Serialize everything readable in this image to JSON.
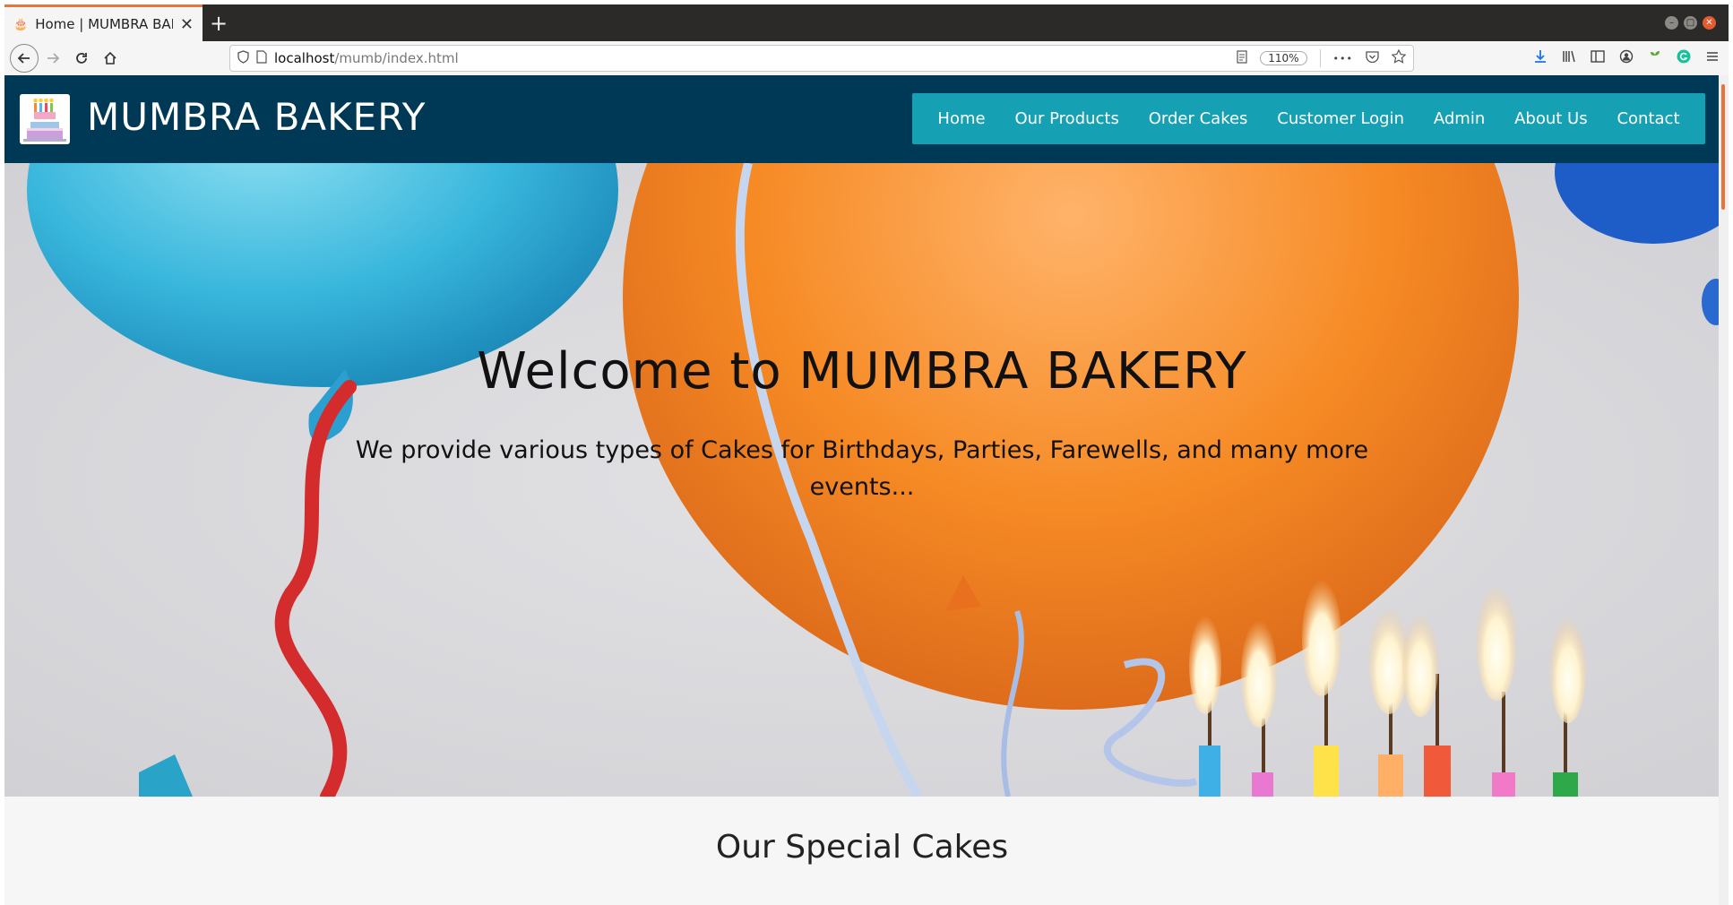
{
  "browser": {
    "tab_title": "Home | MUMBRA BAKERY",
    "tab_close": "✕",
    "new_tab": "+",
    "url_host": "localhost",
    "url_path": "/mumb/index.html",
    "zoom": "110%",
    "menu_dots": "•••"
  },
  "site": {
    "brand": "MUMBRA BAKERY",
    "nav": [
      {
        "label": "Home"
      },
      {
        "label": "Our Products"
      },
      {
        "label": "Order Cakes"
      },
      {
        "label": "Customer Login"
      },
      {
        "label": "Admin"
      },
      {
        "label": "About Us"
      },
      {
        "label": "Contact"
      }
    ]
  },
  "hero": {
    "title": "Welcome to MUMBRA BAKERY",
    "subtitle": "We provide various types of Cakes for Birthdays, Parties, Farewells, and many more events..."
  },
  "special": {
    "heading": "Our Special Cakes"
  },
  "colors": {
    "header_bg": "#003956",
    "menu_bg": "#16a0b4",
    "tab_accent": "#e8733b"
  }
}
